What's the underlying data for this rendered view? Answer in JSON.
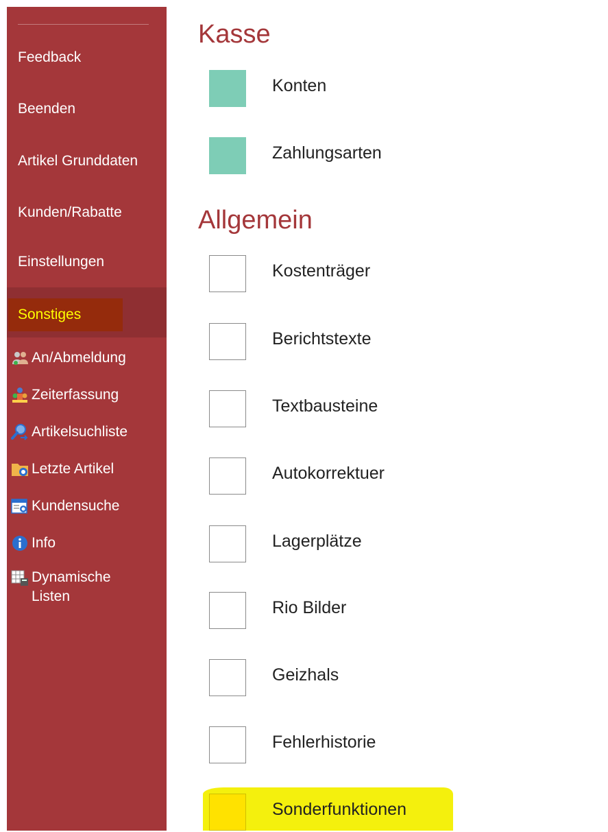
{
  "sidebar": {
    "nav": [
      "Feedback",
      "Beenden",
      "Artikel Grunddaten",
      "Kunden/Rabatte",
      "Einstellungen"
    ],
    "selected": "Sonstiges",
    "tools": [
      {
        "label": "An/Abmeldung",
        "icon": "users-icon"
      },
      {
        "label": "Zeiterfassung",
        "icon": "team-clock-icon"
      },
      {
        "label": "Artikelsuchliste",
        "icon": "search-list-icon"
      },
      {
        "label": "Letzte Artikel",
        "icon": "folder-recent-icon"
      },
      {
        "label": "Kundensuche",
        "icon": "customer-search-icon"
      },
      {
        "label": "Info",
        "icon": "info-icon"
      },
      {
        "label": "Dynamische Listen",
        "icon": "table-calculator-icon"
      }
    ]
  },
  "sections": [
    {
      "title": "Kasse",
      "items": [
        "Konten",
        "Zahlungsarten"
      ]
    },
    {
      "title": "Allgemein",
      "items": [
        "Kostenträger",
        "Berichtstexte",
        "Textbausteine",
        "Autokorrektuer",
        "Lagerplätze",
        "Rio Bilder",
        "Geizhals",
        "Fehlerhistorie",
        "Sonderfunktionen"
      ]
    }
  ],
  "colors": {
    "sidebar": "#a4373a",
    "accent_title": "#a4373a",
    "selected_text": "#ffff00",
    "tile_teal": "#7ecdb6",
    "highlighter": "#f4f00d"
  }
}
